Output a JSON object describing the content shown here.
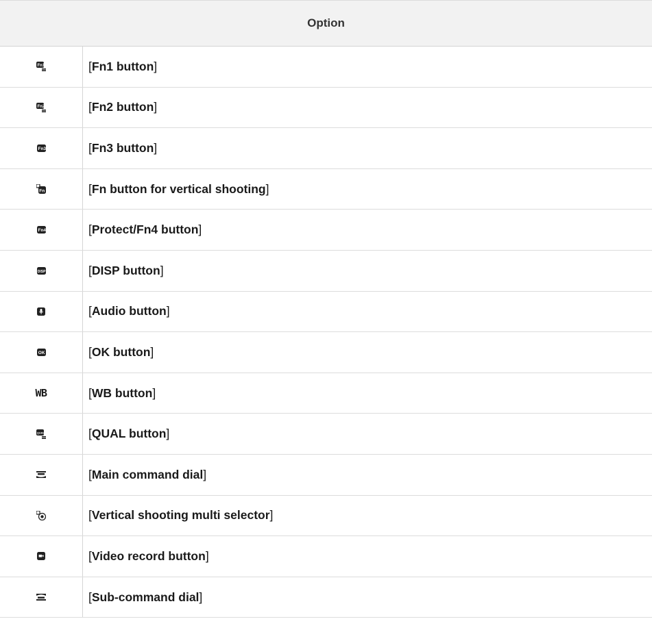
{
  "table": {
    "header": "Option",
    "rows": [
      {
        "icon": "fn1-button-icon",
        "label": "Fn1 button"
      },
      {
        "icon": "fn2-button-icon",
        "label": "Fn2 button"
      },
      {
        "icon": "fn3-button-icon",
        "label": "Fn3 button"
      },
      {
        "icon": "vertical-fn-button-icon",
        "label": "Fn button for vertical shooting"
      },
      {
        "icon": "fn4-button-icon",
        "label": "Protect/Fn4 button"
      },
      {
        "icon": "disp-button-icon",
        "label": "DISP button"
      },
      {
        "icon": "audio-microphone-icon",
        "label": "Audio button"
      },
      {
        "icon": "ok-button-icon",
        "label": "OK button"
      },
      {
        "icon": "wb-button-icon",
        "label": "WB button",
        "icon_text": "WB"
      },
      {
        "icon": "qual-button-icon",
        "label": "QUAL button"
      },
      {
        "icon": "main-command-dial-icon",
        "label": "Main command dial"
      },
      {
        "icon": "vertical-multi-selector-icon",
        "label": "Vertical shooting multi selector"
      },
      {
        "icon": "video-record-button-icon",
        "label": "Video record button"
      },
      {
        "icon": "sub-command-dial-icon",
        "label": "Sub-command dial"
      }
    ]
  }
}
